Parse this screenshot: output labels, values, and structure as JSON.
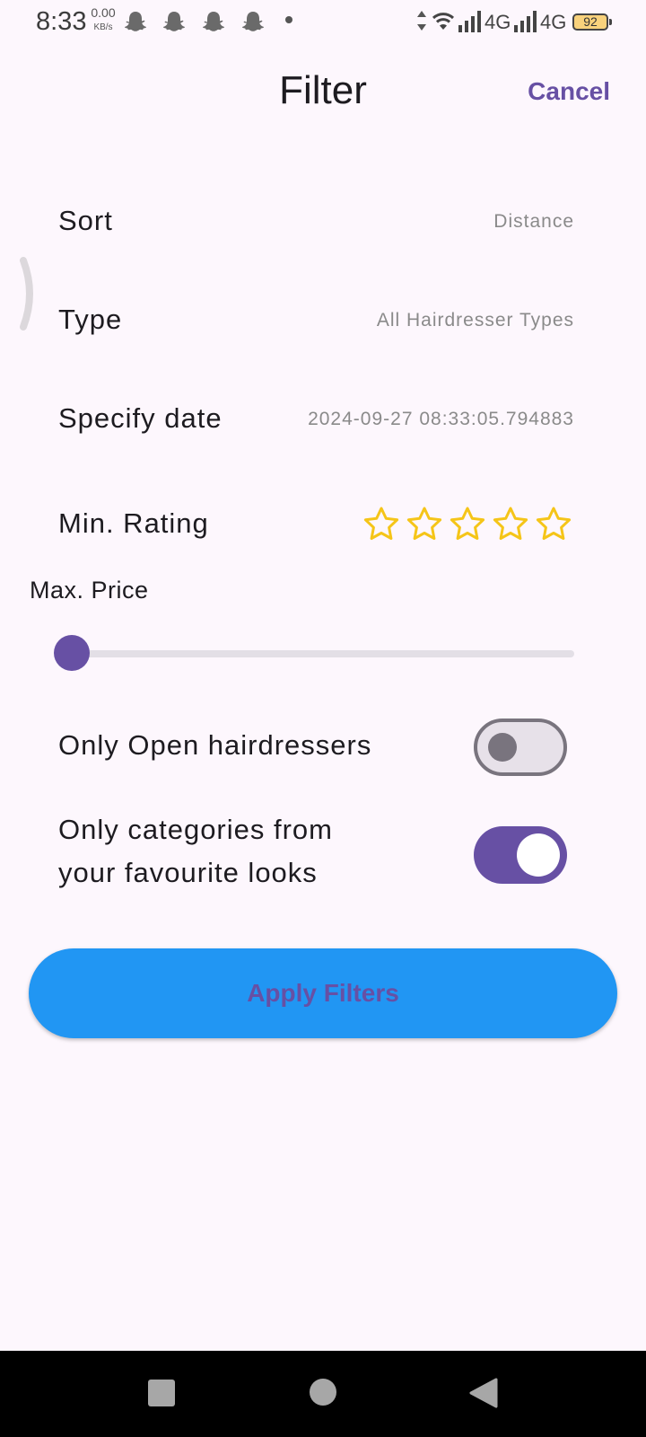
{
  "status_bar": {
    "time": "8:33",
    "net_speed_value": "0.00",
    "net_speed_unit": "KB/s",
    "net1": "4G",
    "net2": "4G",
    "battery": "92",
    "notification_icons": [
      "snapchat-icon",
      "snapchat-icon",
      "snapchat-icon",
      "snapchat-icon"
    ]
  },
  "header": {
    "title": "Filter",
    "cancel_label": "Cancel"
  },
  "filters": {
    "sort": {
      "label": "Sort",
      "value": "Distance"
    },
    "type": {
      "label": "Type",
      "value": "All Hairdresser Types"
    },
    "date": {
      "label": "Specify date",
      "value": "2024-09-27 08:33:05.794883"
    },
    "rating": {
      "label": "Min. Rating",
      "stars_total": 5,
      "stars_selected": 0
    },
    "price": {
      "label": "Max. Price",
      "slider_fraction": 0
    },
    "open_only": {
      "label": "Only Open hairdressers",
      "enabled": false
    },
    "favourite_categories": {
      "label_line1": "Only categories from",
      "label_line2": "your favourite looks",
      "enabled": true
    }
  },
  "apply_label": "Apply Filters",
  "colors": {
    "primary": "#6750a4",
    "apply_button": "#2196f3",
    "star": "#f5c518",
    "background": "#fdf7fd"
  }
}
